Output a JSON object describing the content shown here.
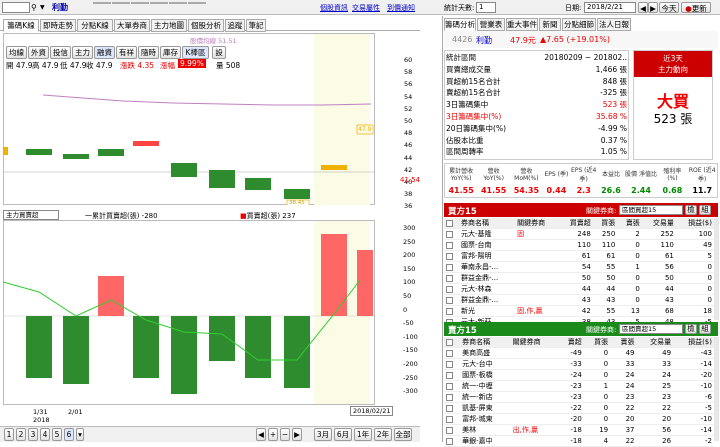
{
  "toolbar": {
    "code_value": "",
    "stock_name": "利勤",
    "left_buttons": [
      "看法",
      "報告",
      "趨勢",
      "主力",
      "哈拉",
      "亂報"
    ],
    "links": [
      "個股資訊",
      "交易屬性",
      "到價通知"
    ],
    "stat_days_label": "統計天數:",
    "stat_days_value": "1",
    "date_label": "日期:",
    "date_value": "2018/2/21",
    "today_label": "今天",
    "refresh_label": "更新"
  },
  "left_tabs": [
    "籌碼K線",
    "即時走勢",
    "分點K線",
    "大單券商",
    "主力地圖",
    "個股分析",
    "追蹤",
    "筆記"
  ],
  "ma_legend": "股價均線 51.51",
  "chart_tools": [
    "均線",
    "外資",
    "投信",
    "主力",
    "融資",
    "有祥",
    "隨時",
    "庫存",
    "K棒區",
    "設"
  ],
  "ohlc": {
    "open": "開 47.9",
    "high": "高 47.9",
    "low": "低 47.9",
    "close": "收 47.9",
    "change_label": "漲跌 4.35",
    "pct_label": "漲幅",
    "pct_value": "9.99%",
    "volume": "量 508"
  },
  "price_axis": [
    "60",
    "58",
    "56",
    "54",
    "52",
    "50",
    "48",
    "46",
    "44",
    "42",
    "40",
    "38",
    "36"
  ],
  "price_markers": {
    "current": "41.54",
    "box": "47.9",
    "low": "38.45"
  },
  "indicator": {
    "select_value": "主力買賣超",
    "legend1": "一累計買賣超(張) -280",
    "legend2": "買賣超(張) 237",
    "axis": [
      "300",
      "250",
      "200",
      "150",
      "100",
      "50",
      "0",
      "-50",
      "-100",
      "-150",
      "-200",
      "-250",
      "-300"
    ]
  },
  "x_labels": {
    "l1": "1/31",
    "l2": "2/01",
    "year": "2018",
    "date_box": "2018/02/21"
  },
  "bottom_nav": {
    "pages": [
      "1",
      "2",
      "3",
      "4",
      "5",
      "6"
    ],
    "ranges": [
      "3月",
      "6月",
      "1年",
      "2年",
      "全部",
      "設置"
    ]
  },
  "right_tabs": [
    "籌碼分析",
    "營業表",
    "重大事件",
    "新聞",
    "分點細節",
    "法人日報"
  ],
  "stock_header": {
    "code": "4426",
    "name": "利勤",
    "price": "47.9元",
    "change": "▲7.65 (+19.01%)"
  },
  "stats": [
    {
      "label": "統計區間",
      "value": "20180209 ~ 201802.."
    },
    {
      "label": "買賣總成交量",
      "value": "1,466 張"
    },
    {
      "label": "買超前15名合計",
      "value": "848 張"
    },
    {
      "label": "賣超前15名合計",
      "value": "-325 張"
    },
    {
      "label": "3日籌碼集中",
      "value": "523 張"
    },
    {
      "label": "3日籌碼集中(%)",
      "value": "35.68 %"
    },
    {
      "label": "20日籌碼集中(%)",
      "value": "-4.99 %"
    },
    {
      "label": "佔股本比重",
      "value": "0.37 %"
    },
    {
      "label": "區間周轉率",
      "value": "1.05 %"
    }
  ],
  "main_force": {
    "title1": "近3天",
    "title2": "主力動向",
    "big": "大買",
    "amount": "523 張"
  },
  "fin_headers": [
    "累計營收 YoY(%)",
    "營收 YoY(%)",
    "營收 MoM(%)",
    "EPS (季)",
    "EPS (近4季)",
    "本益比",
    "股價 淨值比",
    "殖利率 (%)",
    "ROE (近4季)"
  ],
  "fin_values": [
    "41.55",
    "41.55",
    "54.35",
    "0.44",
    "2.3",
    "26.6",
    "2.44",
    "0.68",
    "11.7"
  ],
  "buy_panel": {
    "title": "買方15",
    "filter_label": "關鍵券商:",
    "filter_value": "區間買超15",
    "headers": [
      "券商名稱",
      "關鍵券商",
      "買賣超",
      "買張",
      "賣張",
      "交易量",
      "損益($)"
    ],
    "rows": [
      [
        "元大-基隆",
        "固",
        "248",
        "250",
        "2",
        "252",
        "100"
      ],
      [
        "國票-台南",
        "",
        "110",
        "110",
        "0",
        "110",
        "49"
      ],
      [
        "富邦-陽明",
        "",
        "61",
        "61",
        "0",
        "61",
        "5"
      ],
      [
        "華南永昌-...",
        "",
        "54",
        "55",
        "1",
        "56",
        "0"
      ],
      [
        "群益金鼎-...",
        "",
        "50",
        "50",
        "0",
        "50",
        "0"
      ],
      [
        "元大-林森",
        "",
        "44",
        "44",
        "0",
        "44",
        "0"
      ],
      [
        "群益金鼎-...",
        "",
        "43",
        "43",
        "0",
        "43",
        "0"
      ],
      [
        "新光",
        "固,作,贏",
        "42",
        "55",
        "13",
        "68",
        "18"
      ],
      [
        "元大-新莊",
        "",
        "38",
        "43",
        "5",
        "48",
        "-5"
      ]
    ]
  },
  "sell_panel": {
    "title": "賣方15",
    "filter_label": "關鍵券商:",
    "filter_value": "區間賣超15",
    "headers": [
      "券商名稱",
      "關鍵券商",
      "賣超",
      "買張",
      "賣張",
      "交易量",
      "損益($)"
    ],
    "rows": [
      [
        "美商高盛",
        "",
        "-49",
        "0",
        "49",
        "49",
        "-43"
      ],
      [
        "元大-台中",
        "",
        "-33",
        "0",
        "33",
        "33",
        "-14"
      ],
      [
        "國票-板橋",
        "",
        "-24",
        "0",
        "24",
        "24",
        "-20"
      ],
      [
        "統一-中壢",
        "",
        "-23",
        "1",
        "24",
        "25",
        "-10"
      ],
      [
        "統一-新店",
        "",
        "-23",
        "0",
        "23",
        "23",
        "-6"
      ],
      [
        "凱基-屏東",
        "",
        "-22",
        "0",
        "22",
        "22",
        "-5"
      ],
      [
        "富邦-城東",
        "",
        "-20",
        "0",
        "20",
        "20",
        "-10"
      ],
      [
        "美林",
        "出,作,贏",
        "-18",
        "19",
        "37",
        "56",
        "-14"
      ],
      [
        "華銀-嘉中",
        "",
        "-18",
        "4",
        "22",
        "26",
        "-2"
      ]
    ]
  },
  "colors": {
    "up": "#ff4444",
    "down": "#2e8b2e",
    "accent": "#cc0000",
    "header_bg": "#cc0000",
    "sell_bg": "#1a8a1a"
  }
}
